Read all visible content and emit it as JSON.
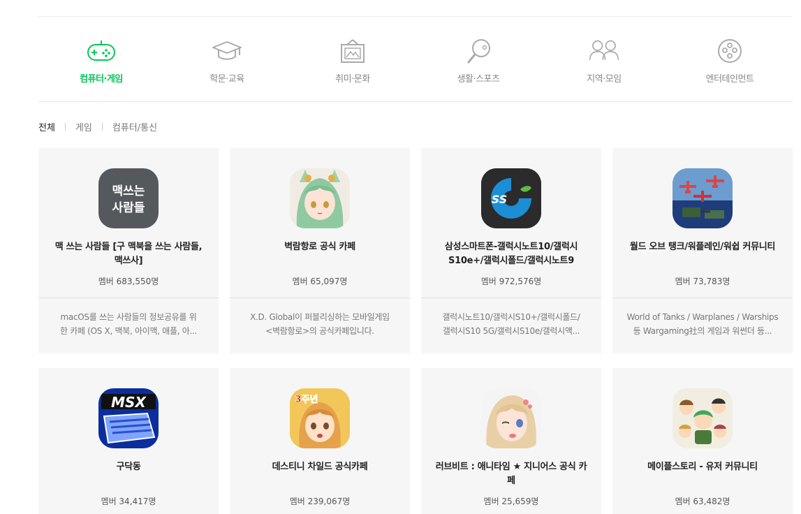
{
  "categories": [
    {
      "label": "컴퓨터·게임",
      "icon": "gamepad-icon",
      "active": true
    },
    {
      "label": "학문·교육",
      "icon": "graduation-cap-icon",
      "active": false
    },
    {
      "label": "취미·문화",
      "icon": "picture-frame-icon",
      "active": false
    },
    {
      "label": "생활·스포츠",
      "icon": "ping-pong-icon",
      "active": false
    },
    {
      "label": "지역·모임",
      "icon": "people-icon",
      "active": false
    },
    {
      "label": "엔터테인먼트",
      "icon": "film-reel-icon",
      "active": false
    }
  ],
  "subtabs": [
    "전체",
    "게임",
    "컴퓨터/통신"
  ],
  "colors": {
    "accent": "#03c75a",
    "card_bg": "#f6f6f6"
  },
  "cafes": [
    {
      "name": "맥 쓰는 사람들 [구 맥북을 쓰는 사람들, 맥쓰사]",
      "members": "멤버 683,550명",
      "desc1": "macOS를 쓰는 사람들의 정보공유를 위",
      "desc2": "한 카페 (OS X, 맥북, 아이맥, 애플, 아...",
      "icon": "mac-users-icon",
      "icon_text": "맥쓰는\n사람들"
    },
    {
      "name": "벽람항로 공식 카페",
      "members": "멤버 65,097명",
      "desc1": "X.D. Global이 퍼블리싱하는 모바일게임",
      "desc2": "<벽람항로>의 공식카페입니다.",
      "icon": "anime-girl-icon",
      "icon_text": ""
    },
    {
      "name": "삼성스마트폰-갤럭시노트10/갤럭시S10e+/갤럭시폴드/갤럭시노트9",
      "members": "멤버 972,576명",
      "desc1": "갤럭시노트10/갤럭시S10+/갤럭시폴드/",
      "desc2": "갤럭시S10 5G/갤럭시S10e/갤럭시액...",
      "icon": "ss-logo-icon",
      "icon_text": "SS"
    },
    {
      "name": "월드 오브 탱크/워플레인/워쉽 커뮤니티",
      "members": "멤버 73,783명",
      "desc1": "World of Tanks / Warplanes / Warships",
      "desc2": "등 Wargaming社의 게임과 워썬더 등...",
      "icon": "warplanes-icon",
      "icon_text": ""
    },
    {
      "name": "구닥동",
      "members": "멤버 34,417명",
      "desc1": "",
      "desc2": "",
      "icon": "msx-keyboard-icon",
      "icon_text": "MSX"
    },
    {
      "name": "데스티니 차일드 공식카페",
      "members": "멤버 239,067명",
      "desc1": "",
      "desc2": "",
      "icon": "destiny-child-icon",
      "icon_text": "3주년"
    },
    {
      "name": "러브비트 : 애니타임 ★ 지니어스 공식 카페",
      "members": "멤버 25,659명",
      "desc1": "",
      "desc2": "",
      "icon": "winking-girl-icon",
      "icon_text": ""
    },
    {
      "name": "메이플스토리 - 유저 커뮤니티",
      "members": "멤버 63,482명",
      "desc1": "",
      "desc2": "",
      "icon": "maplestory-characters-icon",
      "icon_text": ""
    }
  ]
}
